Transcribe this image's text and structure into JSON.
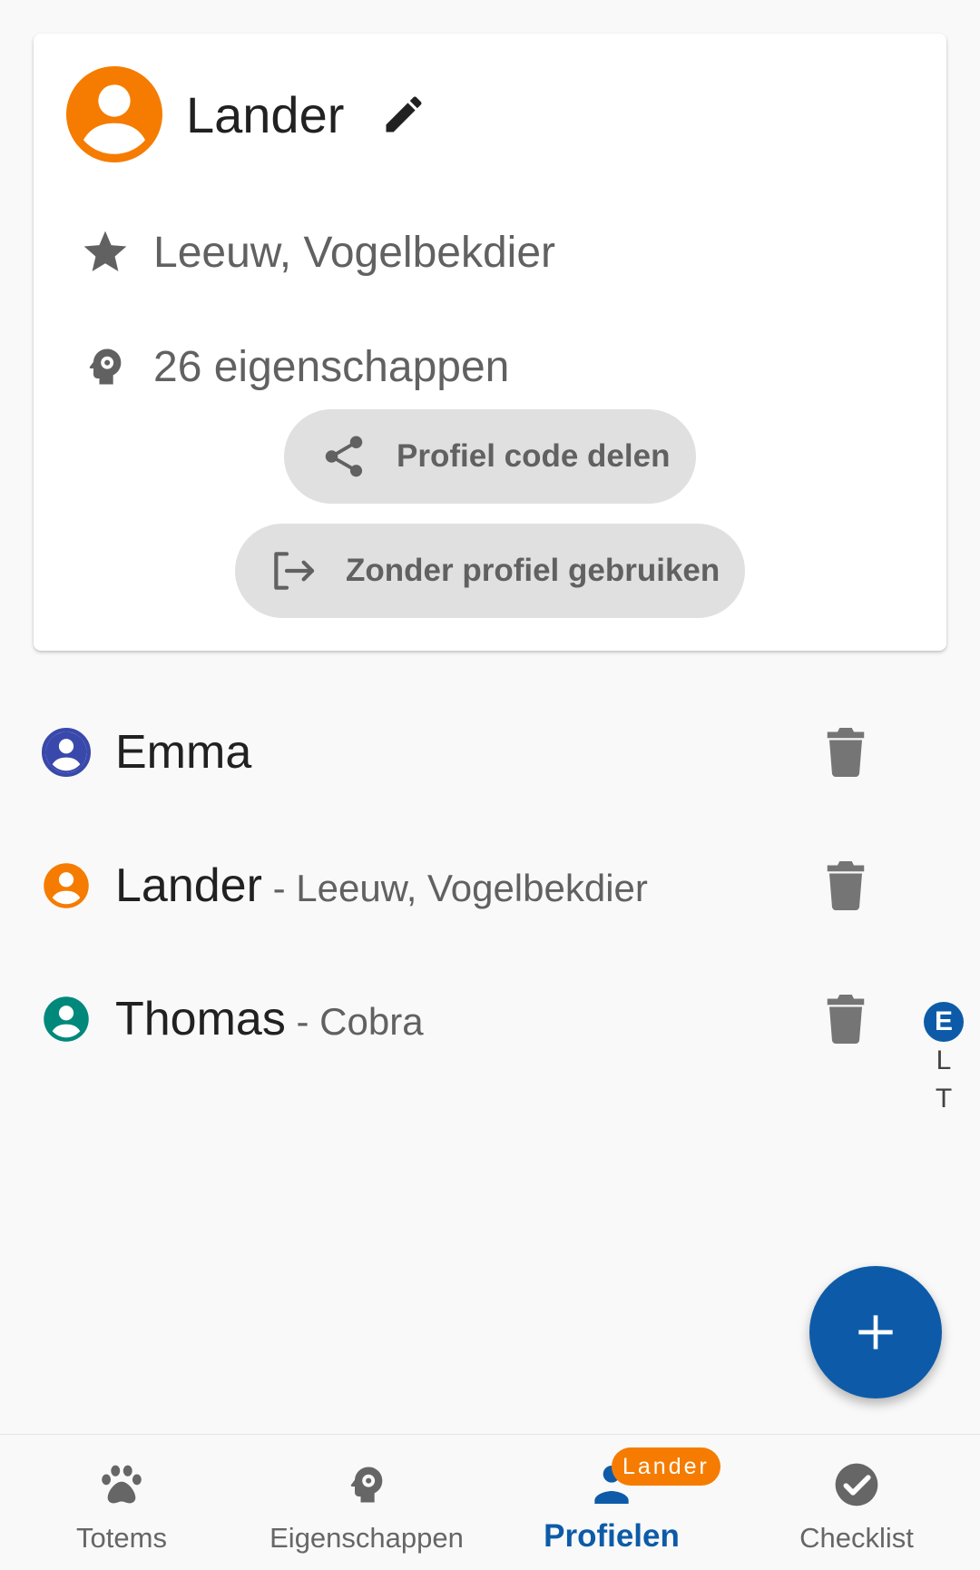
{
  "colors": {
    "accent": "#0d5ba8",
    "orange": "#f57c00",
    "indigo": "#3949ab",
    "teal": "#00897b",
    "icon_grey": "#757575"
  },
  "card": {
    "name": "Lander",
    "totems": "Leeuw, Vogelbekdier",
    "traits": "26 eigenschappen",
    "share_button": "Profiel code delen",
    "no_profile_button": "Zonder profiel gebruiken",
    "icons": [
      "account-circle-icon",
      "pencil-icon",
      "star-icon",
      "head-cog-icon",
      "share-icon",
      "exit-icon"
    ]
  },
  "profiles": [
    {
      "name": "Emma",
      "subtitle": ""
    },
    {
      "name": "Lander",
      "subtitle": " - Leeuw, Vogelbekdier"
    },
    {
      "name": "Thomas",
      "subtitle": " - Cobra"
    }
  ],
  "alphabet_index": [
    "E",
    "L",
    "T"
  ],
  "fab": {
    "icon": "plus-icon"
  },
  "bottom_nav": {
    "items": [
      {
        "label": "Totems",
        "icon": "paw-icon"
      },
      {
        "label": "Eigenschappen",
        "icon": "head-cog-icon"
      },
      {
        "label": "Profielen",
        "icon": "person-icon",
        "active": true
      },
      {
        "label": "Checklist",
        "icon": "check-circle-icon"
      }
    ],
    "badge": "Lander"
  }
}
